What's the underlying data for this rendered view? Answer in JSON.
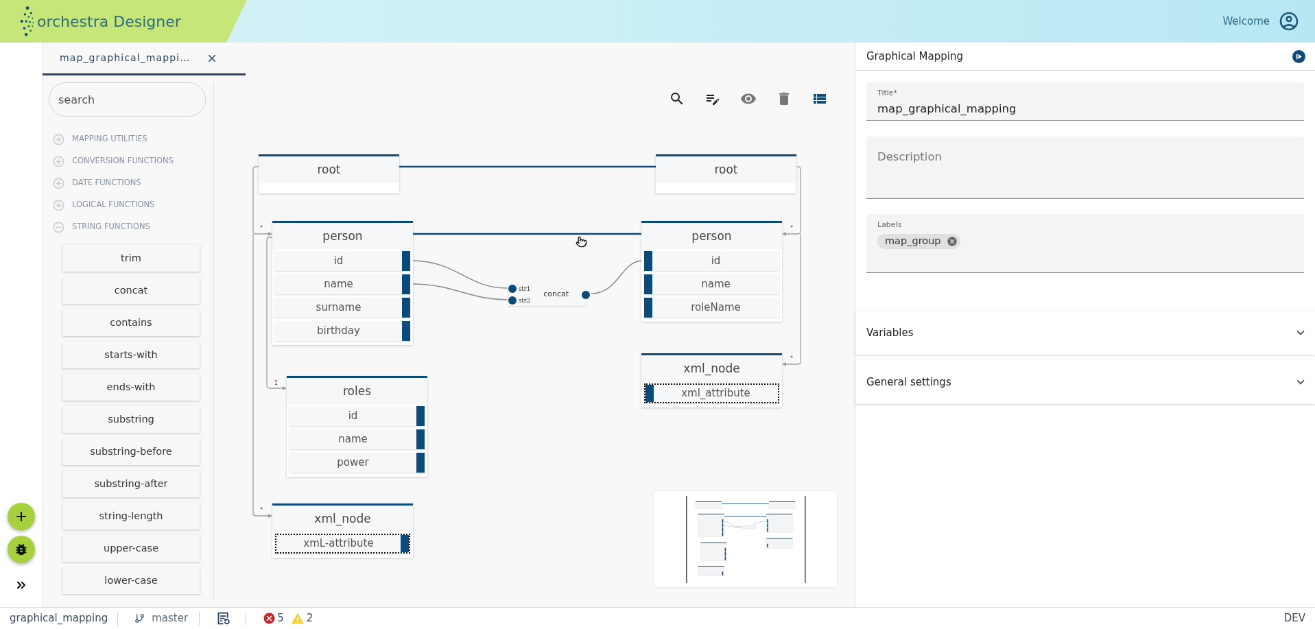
{
  "header": {
    "app_name": "orchestra Designer",
    "welcome": "Welcome"
  },
  "editor_tab": {
    "label": "map_graphical_mappi…",
    "selected": true
  },
  "sidebar": {
    "search": {
      "placeholder": "search"
    },
    "categories": [
      {
        "label": "MAPPING UTILITIES",
        "expanded": false
      },
      {
        "label": "CONVERSION FUNCTIONS",
        "expanded": false
      },
      {
        "label": "DATE FUNCTIONS",
        "expanded": false
      },
      {
        "label": "LOGICAL FUNCTIONS",
        "expanded": false
      },
      {
        "label": "STRING FUNCTIONS",
        "expanded": true,
        "functions": [
          "trim",
          "concat",
          "contains",
          "starts-with",
          "ends-with",
          "substring",
          "substring-before",
          "substring-after",
          "string-length",
          "upper-case",
          "lower-case"
        ]
      }
    ]
  },
  "toolbar": [
    {
      "kind": "search",
      "disabled": false,
      "selected": false
    },
    {
      "kind": "edit",
      "disabled": false,
      "selected": false
    },
    {
      "kind": "preview",
      "disabled": true,
      "selected": false
    },
    {
      "kind": "delete",
      "disabled": true,
      "selected": false
    },
    {
      "kind": "list",
      "disabled": false,
      "selected": true
    }
  ],
  "canvas": {
    "source_nodes": [
      {
        "title": "root"
      },
      {
        "title": "person",
        "cardinality": "*",
        "fields": [
          {
            "label": "id",
            "kind": "element"
          },
          {
            "label": "name",
            "kind": "element"
          },
          {
            "label": "surname",
            "kind": "element"
          },
          {
            "label": "birthday",
            "kind": "element"
          }
        ]
      },
      {
        "title": "roles",
        "cardinality": "1",
        "fields": [
          {
            "label": "id",
            "kind": "element"
          },
          {
            "label": "name",
            "kind": "element"
          },
          {
            "label": "power",
            "kind": "element"
          }
        ]
      },
      {
        "title": "xml_node",
        "cardinality": "*",
        "fields": [
          {
            "label": "xmL-attribute",
            "kind": "attribute"
          }
        ]
      }
    ],
    "target_nodes": [
      {
        "title": "root"
      },
      {
        "title": "person",
        "cardinality": "*",
        "fields": [
          {
            "label": "id",
            "kind": "element"
          },
          {
            "label": "name",
            "kind": "element"
          },
          {
            "label": "roleName",
            "kind": "element"
          }
        ]
      },
      {
        "title": "xml_node",
        "cardinality": "*",
        "fields": [
          {
            "label": "xml_attribute",
            "kind": "attribute"
          }
        ]
      }
    ],
    "functions": [
      {
        "name": "concat",
        "inputs": [
          "str1",
          "str2"
        ]
      }
    ]
  },
  "properties": {
    "title": "Graphical Mapping",
    "title_field": {
      "label": "Title*",
      "value": "map_graphical_mapping"
    },
    "description_field": {
      "placeholder": "Description"
    },
    "labels_field": {
      "label": "Labels",
      "chips": [
        "map_group"
      ]
    },
    "sections": [
      {
        "label": "Variables",
        "expanded": false
      },
      {
        "label": "General settings",
        "expanded": false
      }
    ]
  },
  "status_bar": {
    "project": "graphical_mapping",
    "branch": "master",
    "errors": "5",
    "warnings": "2",
    "environment": "DEV"
  }
}
